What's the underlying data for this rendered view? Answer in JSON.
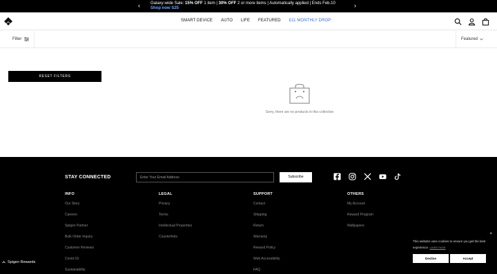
{
  "announcement": {
    "prev_arrow": "‹",
    "next_arrow": "›",
    "lead": "Galaxy-wide Sale: ",
    "offer1": "15% OFF",
    "mid1": " 1 item | ",
    "offer2": "30% OFF",
    "tail": " 2 or more items | Automatically applied | Ends Feb.10",
    "link": "Shop now S25"
  },
  "nav": {
    "items": [
      "SMART DEVICE",
      "AUTO",
      "LIFE",
      "FEATURED"
    ],
    "accent_item": "£11 MONTHLY DROP",
    "accent_color": "#3a6cd1"
  },
  "header_icons": [
    "search-icon",
    "account-icon",
    "bag-icon"
  ],
  "filterbar": {
    "filter_label": "Filter",
    "sort_label": "Featured"
  },
  "sidebar": {
    "reset_label": "RESET FILTERS"
  },
  "empty_state": {
    "message": "Sorry, there are no products in this collection"
  },
  "footer": {
    "stay_connected": "STAY CONNECTED",
    "email_placeholder": "Enter Your Email Address",
    "subscribe_label": "Subscribe",
    "social_icons": [
      "facebook-icon",
      "instagram-icon",
      "x-icon",
      "youtube-icon",
      "tiktok-icon"
    ],
    "columns": [
      {
        "title": "INFO",
        "links": [
          "Our Story",
          "Careers",
          "Spigen Partner",
          "Bulk Order Inquiry",
          "Customer Reviews",
          "Covid-19",
          "Sustainability"
        ]
      },
      {
        "title": "LEGAL",
        "links": [
          "Privacy",
          "Terms",
          "Intellectual Properties",
          "Counterfeits"
        ]
      },
      {
        "title": "SUPPORT",
        "links": [
          "Contact",
          "Shipping",
          "Return",
          "Warranty",
          "Reward Policy",
          "Web Accessibility",
          "FAQ"
        ]
      },
      {
        "title": "OTHERS",
        "links": [
          "My Account",
          "Reward Program",
          "Wallpapers"
        ]
      }
    ]
  },
  "rewards": {
    "label": "Spigen Rewards"
  },
  "cookie": {
    "close": "×",
    "text": "This website uses cookies to ensure you get the best experience. ",
    "learn_more": "Learn more",
    "decline": "Decline",
    "accept": "Accept"
  }
}
